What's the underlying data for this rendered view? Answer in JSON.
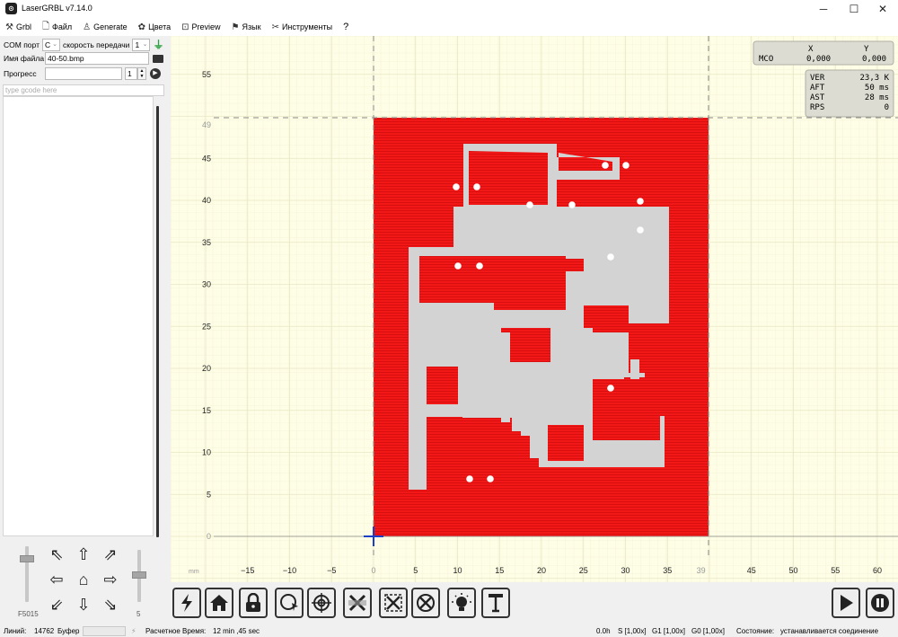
{
  "window": {
    "title": "LaserGRBL v7.14.0",
    "minimize": "─",
    "maximize": "☐",
    "close": "✕"
  },
  "menu": [
    {
      "label": "Grbl",
      "icon": "tools-icon",
      "glyph": "⚒"
    },
    {
      "label": "Файл",
      "icon": "file-icon",
      "glyph": "🗋"
    },
    {
      "label": "Generate",
      "icon": "generate-icon",
      "glyph": "♙"
    },
    {
      "label": "Цвета",
      "icon": "palette-icon",
      "glyph": "✿"
    },
    {
      "label": "Preview",
      "icon": "preview-icon",
      "glyph": "⊡"
    },
    {
      "label": "Язык",
      "icon": "flag-icon",
      "glyph": "⚑"
    },
    {
      "label": "Инструменты",
      "icon": "wrench-icon",
      "glyph": "✂"
    },
    {
      "label": "?",
      "icon": "help-icon",
      "glyph": ""
    }
  ],
  "left": {
    "com_label": "COM порт",
    "com_value": "C",
    "baud_label": "скорость передачи",
    "baud_value": "1",
    "file_label": "Имя файла",
    "file_value": "40-50.bmp",
    "progress_label": "Прогресс",
    "progress_count": "1",
    "cmd_placeholder": "type gcode here",
    "feed_label": "F5015",
    "step_label": "5"
  },
  "jog_glyphs": {
    "nw": "⇖",
    "n": "⇧",
    "ne": "⇗",
    "w": "⇦",
    "home": "⌂",
    "e": "⇨",
    "sw": "⇙",
    "s": "⇩",
    "se": "⇘"
  },
  "overlay": {
    "x_header": "X",
    "y_header": "Y",
    "mco_label": "MCO",
    "mco_x": "0,000",
    "mco_y": "0,000",
    "stats": [
      {
        "label": "VER",
        "value": "23,3 K"
      },
      {
        "label": "AFT",
        "value": "50 ms"
      },
      {
        "label": "AST",
        "value": "28 ms"
      },
      {
        "label": "RPS",
        "value": "0"
      }
    ]
  },
  "axis": {
    "unit": "mm",
    "x_ticks": [
      "−15",
      "−10",
      "−5",
      "0",
      "5",
      "10",
      "15",
      "20",
      "25",
      "30",
      "35",
      "39",
      "45",
      "50",
      "55",
      "60"
    ],
    "y_ticks": [
      "0",
      "5",
      "10",
      "15",
      "20",
      "25",
      "30",
      "35",
      "40",
      "45",
      "49",
      "55"
    ]
  },
  "colors": {
    "engrave": "#f02020",
    "trace": "#d3d3d3",
    "grid_bg": "#fefde6",
    "cross": "#1a3fc8"
  },
  "status": {
    "lines_label": "Линий:",
    "lines_value": "14762",
    "buffer_label": "Буфер",
    "time_label": "Расчетное Время:",
    "time_value": "12 min ,45 sec",
    "elapsed": "0.0h",
    "s_override": "S [1,00x]",
    "g1_override": "G1 [1,00x]",
    "g0_override": "G0 [1,00x]",
    "state_label": "Состояние:",
    "state_value": "устанавливается соединение"
  },
  "tools": [
    "reset-icon",
    "home-icon",
    "unlock-icon",
    "center-icon",
    "target-icon",
    "frame-icon",
    "corner-frame-icon",
    "cross-frame-icon",
    "light-icon",
    "probe-icon"
  ]
}
